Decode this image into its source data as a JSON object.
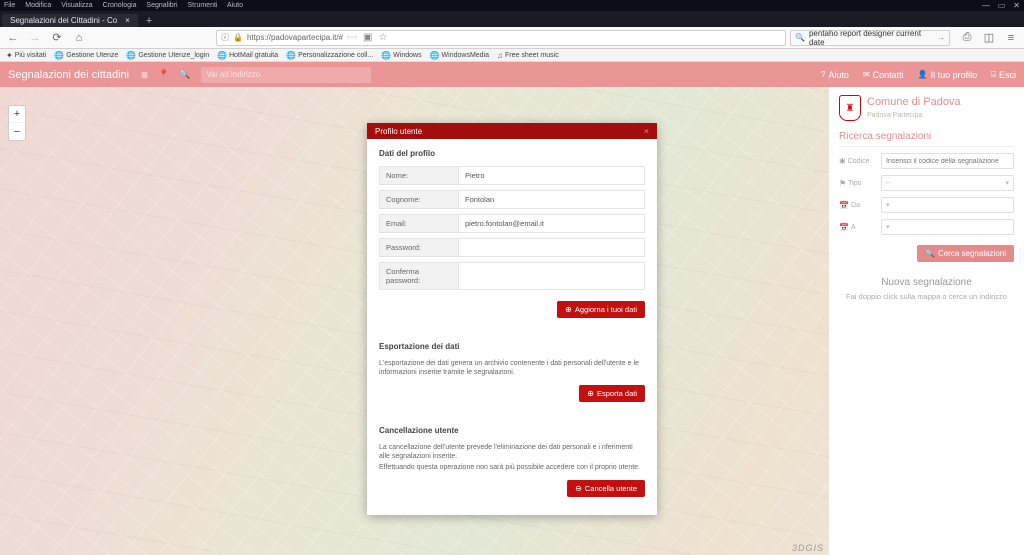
{
  "browser": {
    "menu": [
      "File",
      "Modifica",
      "Visualizza",
      "Cronologia",
      "Segnalibri",
      "Strumenti",
      "Aiuto"
    ],
    "tab_title": "Segnalazioni dei Cittadini - Co",
    "url_display": "https://padovapartecipa.it/#",
    "search_value": "pentaho report designer current date",
    "bookmarks": [
      "Più visitati",
      "Gestione Utenze",
      "Gestione Utenze_login",
      "HotMail gratuita",
      "Personalizzazione coll...",
      "Windows",
      "WindowsMedia",
      "Free sheet music"
    ]
  },
  "appbar": {
    "title": "Segnalazioni dei cittadini",
    "address_placeholder": "Vai ad indirizzo",
    "links": {
      "aiuto": "Aiuto",
      "contatti": "Contatti",
      "profilo": "Il tuo profilo",
      "esci": "Esci"
    }
  },
  "brand": {
    "name": "Comune di Padova",
    "sub": "Padova Partecipa"
  },
  "search": {
    "title": "Ricerca segnalazioni",
    "codice_label": "Codice",
    "codice_placeholder": "Inserisci il codice della segnalazione",
    "tipo_label": "Tipo",
    "tipo_value": "--",
    "da_label": "Da",
    "a_label": "A",
    "button": "Cerca segnalazioni"
  },
  "newreport": {
    "title": "Nuova segnalazione",
    "sub": "Fai doppio click sulla mappa o cerca un indirizzo"
  },
  "dialog": {
    "title": "Profilo utente",
    "section_profile": "Dati del profilo",
    "labels": {
      "nome": "Nome:",
      "cognome": "Cognome:",
      "email": "Email:",
      "password": "Password:",
      "conferma": "Conferma password:"
    },
    "values": {
      "nome": "Pietro",
      "cognome": "Fontolan",
      "email": "pietro.fontolan@email.it",
      "password": "",
      "conferma": ""
    },
    "btn_update": "Aggiorna i tuoi dati",
    "section_export": "Esportazione dei dati",
    "export_desc": "L'esportazione dei dati genera un archivio contenente i dati personali dell'utente e le informazioni inserite tramite le segnalazioni.",
    "btn_export": "Esporta dati",
    "section_delete": "Cancellazione utente",
    "delete_desc1": "La cancellazione dell'utente prevede l'eliminazione dei dati personali e i riferimenti alle segnalazioni inserite.",
    "delete_desc2": "Effettuando questa operazione non sarà più possibile accedere con il proprio utente.",
    "btn_delete": "Cancella utente"
  },
  "map": {
    "attribution": "3DGIS"
  }
}
